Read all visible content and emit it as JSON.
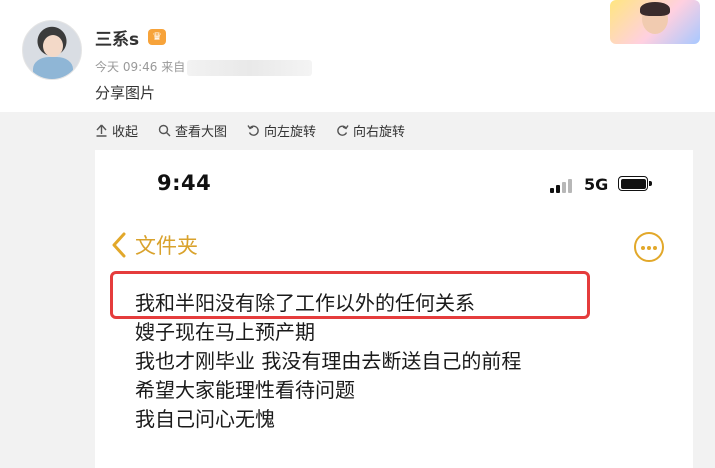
{
  "post": {
    "username": "三系s",
    "badge": "♛",
    "timestamp": "今天 09:46",
    "source_prefix": "来自",
    "text": "分享图片"
  },
  "toolbar": {
    "collapse": "收起",
    "view_large": "查看大图",
    "rotate_left": "向左旋转",
    "rotate_right": "向右旋转"
  },
  "phone": {
    "time": "9:44",
    "network": "5G",
    "signal_bars_active": 2,
    "battery_level": 1.0,
    "back_label": "文件夹",
    "more_icon": "ellipsis-circle-icon",
    "note_lines": [
      "我和半阳没有除了工作以外的任何关系",
      "嫂子现在马上预产期",
      "我也才刚毕业  我没有理由去断送自己的前程",
      "希望大家能理性看待问题",
      "我自己问心无愧"
    ]
  },
  "colors": {
    "accent": "#E2A82A",
    "highlight": "#E53C3C",
    "gallery_bg": "#F2F2F2"
  }
}
